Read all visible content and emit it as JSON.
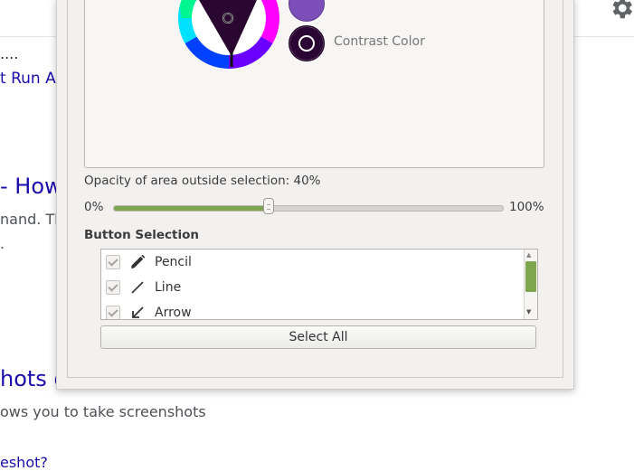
{
  "background_page": {
    "line1": "....",
    "link1": "t Run Ar",
    "heading1": "- How",
    "body1": "nand. Th",
    "body2": ".",
    "heading2": "hots o",
    "body3": "ows you to take screenshots",
    "link2": "eshot?"
  },
  "dialog": {
    "contrast_color_label": "Contrast Color",
    "primary_color": "#7b4fb7",
    "contrast_color": "#2b0533",
    "opacity": {
      "label": "Opacity of area outside selection: 40%",
      "min_label": "0%",
      "max_label": "100%",
      "value_percent": 40
    },
    "button_selection": {
      "heading": "Button Selection",
      "items": [
        {
          "label": "Pencil",
          "icon": "pencil-icon",
          "checked": true
        },
        {
          "label": "Line",
          "icon": "line-icon",
          "checked": true
        },
        {
          "label": "Arrow",
          "icon": "arrow-icon",
          "checked": true
        }
      ],
      "select_all_label": "Select All"
    },
    "accent_color": "#7ea64f"
  }
}
